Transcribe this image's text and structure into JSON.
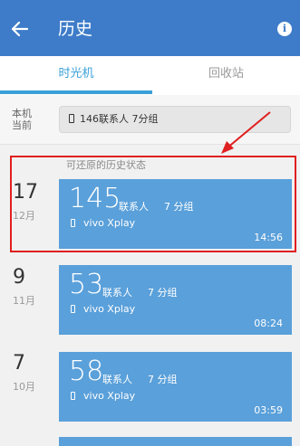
{
  "appbar": {
    "title": "历史",
    "info_glyph": "i",
    "color": "#3e7cc9"
  },
  "tabs": [
    {
      "label": "时光机",
      "active": true
    },
    {
      "label": "回收站",
      "active": false
    }
  ],
  "current": {
    "label_line1": "本机",
    "label_line2": "当前",
    "summary": "146联系人  7分组"
  },
  "hint": "可还原的历史状态",
  "entries": [
    {
      "day": "17",
      "month": "12月",
      "count": "145",
      "contacts_label": "联系人",
      "groups": "7 分组",
      "device": "vivo Xplay",
      "time": "14:56"
    },
    {
      "day": "9",
      "month": "11月",
      "count": "53",
      "contacts_label": "联系人",
      "groups": "7 分组",
      "device": "vivo Xplay",
      "time": "08:24"
    },
    {
      "day": "7",
      "month": "10月",
      "count": "58",
      "contacts_label": "联系人",
      "groups": "7 分组",
      "device": "vivo Xplay",
      "time": "03:59"
    }
  ],
  "colors": {
    "accent": "#3aa0d8",
    "card": "#5aa0da",
    "annotation": "#e02020"
  }
}
